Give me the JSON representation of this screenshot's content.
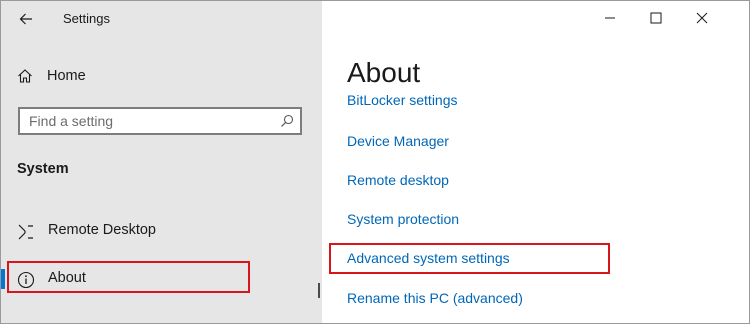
{
  "window": {
    "app_title": "Settings",
    "caption_buttons": [
      "minimize-icon",
      "maximize-icon",
      "close-icon"
    ]
  },
  "sidebar": {
    "home_label": "Home",
    "search": {
      "placeholder": "Find a setting",
      "value": ""
    },
    "section_title": "System",
    "items": [
      {
        "label": "Remote Desktop",
        "icon": "remote-desktop-icon",
        "selected": false
      },
      {
        "label": "About",
        "icon": "info-icon",
        "selected": true
      }
    ]
  },
  "main": {
    "title": "About",
    "links": [
      "BitLocker settings",
      "Device Manager",
      "Remote desktop",
      "System protection",
      "Advanced system settings",
      "Rename this PC (advanced)"
    ]
  },
  "colors": {
    "sidebar_bg": "#e6e6e6",
    "link": "#0067b8",
    "accent": "#0078d7",
    "highlight": "#d9141b"
  }
}
